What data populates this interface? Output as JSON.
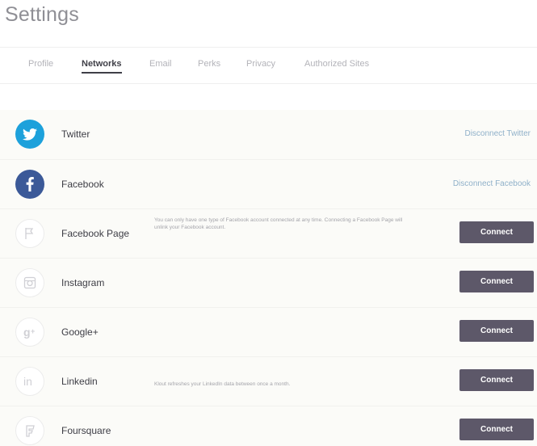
{
  "page": {
    "title": "Settings"
  },
  "tabs": [
    {
      "label": "Profile"
    },
    {
      "label": "Networks"
    },
    {
      "label": "Email"
    },
    {
      "label": "Perks"
    },
    {
      "label": "Privacy"
    },
    {
      "label": "Authorized Sites"
    }
  ],
  "active_tab": "Networks",
  "colors": {
    "twitter": "#1da1db",
    "facebook": "#3b5998",
    "connect_button": "#5d5869",
    "disconnect_link": "#8fb0c9"
  },
  "networks": [
    {
      "name": "Twitter",
      "icon": "twitter-bird-icon",
      "action_label": "Disconnect Twitter",
      "connected": true
    },
    {
      "name": "Facebook",
      "icon": "facebook-f-icon",
      "action_label": "Disconnect Facebook",
      "connected": true
    },
    {
      "name": "Facebook Page",
      "icon": "flag-icon",
      "action_label": "Connect",
      "connected": false,
      "description": "You can only have one type of Facebook account connected at any time. Connecting a Facebook Page will unlink your Facebook account."
    },
    {
      "name": "Instagram",
      "icon": "camera-icon",
      "action_label": "Connect",
      "connected": false
    },
    {
      "name": "Google+",
      "icon": "google-plus-icon",
      "action_label": "Connect",
      "connected": false
    },
    {
      "name": "Linkedin",
      "icon": "linkedin-icon",
      "action_label": "Connect",
      "connected": false,
      "description": "Klout refreshes your LinkedIn data between once a month."
    },
    {
      "name": "Foursquare",
      "icon": "foursquare-icon",
      "action_label": "Connect",
      "connected": false
    }
  ]
}
